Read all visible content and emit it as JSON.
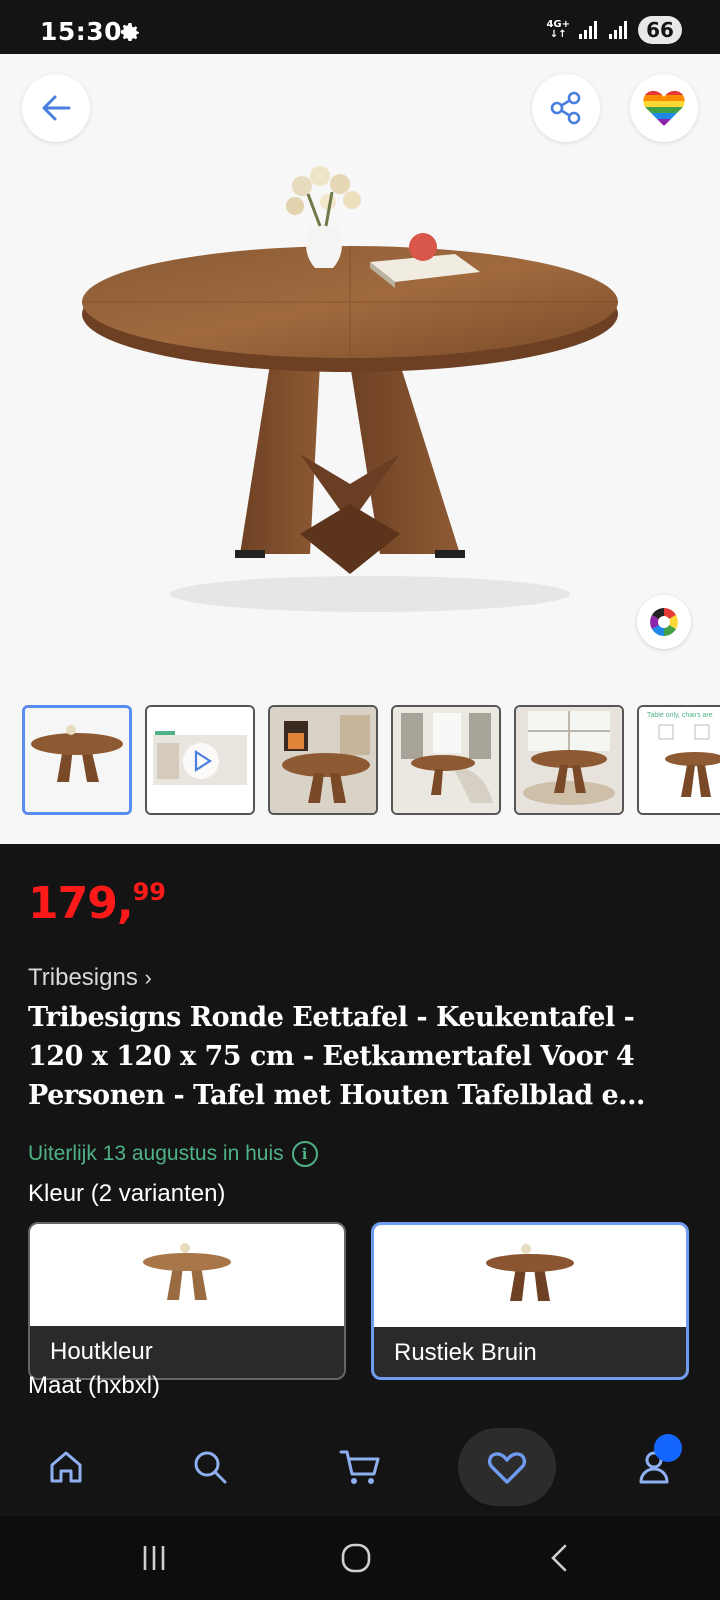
{
  "status_bar": {
    "time": "15:30",
    "network": "4G+",
    "battery": "66"
  },
  "product": {
    "price_main": "179,",
    "price_cents": "99",
    "brand": "Tribesigns",
    "title": "Tribesigns Ronde Eettafel - Keukentafel - 120 x 120 x 75 cm - Eetkamertafel Voor 4 Personen - Tafel met Houten Tafelblad e...",
    "delivery": "Uiterlijk 13 augustus in huis",
    "colour_label": "Kleur (2 varianten)",
    "size_label": "Maat (hxbxl)",
    "variants": [
      {
        "label": "Houtkleur",
        "selected": false
      },
      {
        "label": "Rustiek Bruin",
        "selected": true
      }
    ],
    "thumbnails": [
      "table-photo",
      "video",
      "living-room-fireplace",
      "dining-room-bench",
      "dining-room-window",
      "dimensions-sheet"
    ]
  },
  "thumbnail_texts": {
    "dimensions_note": "Table only, chairs are"
  },
  "colors": {
    "price": "#ff1a1a",
    "delivery": "#4fb286",
    "accent": "#5b8def",
    "background": "#141414",
    "badge": "#1565ff"
  },
  "icons": {
    "back": "arrow-left-icon",
    "share": "share-icon",
    "favorite": "rainbow-heart-icon",
    "colors": "color-wheel-icon",
    "nav": [
      "home-icon",
      "search-icon",
      "cart-icon",
      "heart-icon",
      "account-icon"
    ]
  }
}
